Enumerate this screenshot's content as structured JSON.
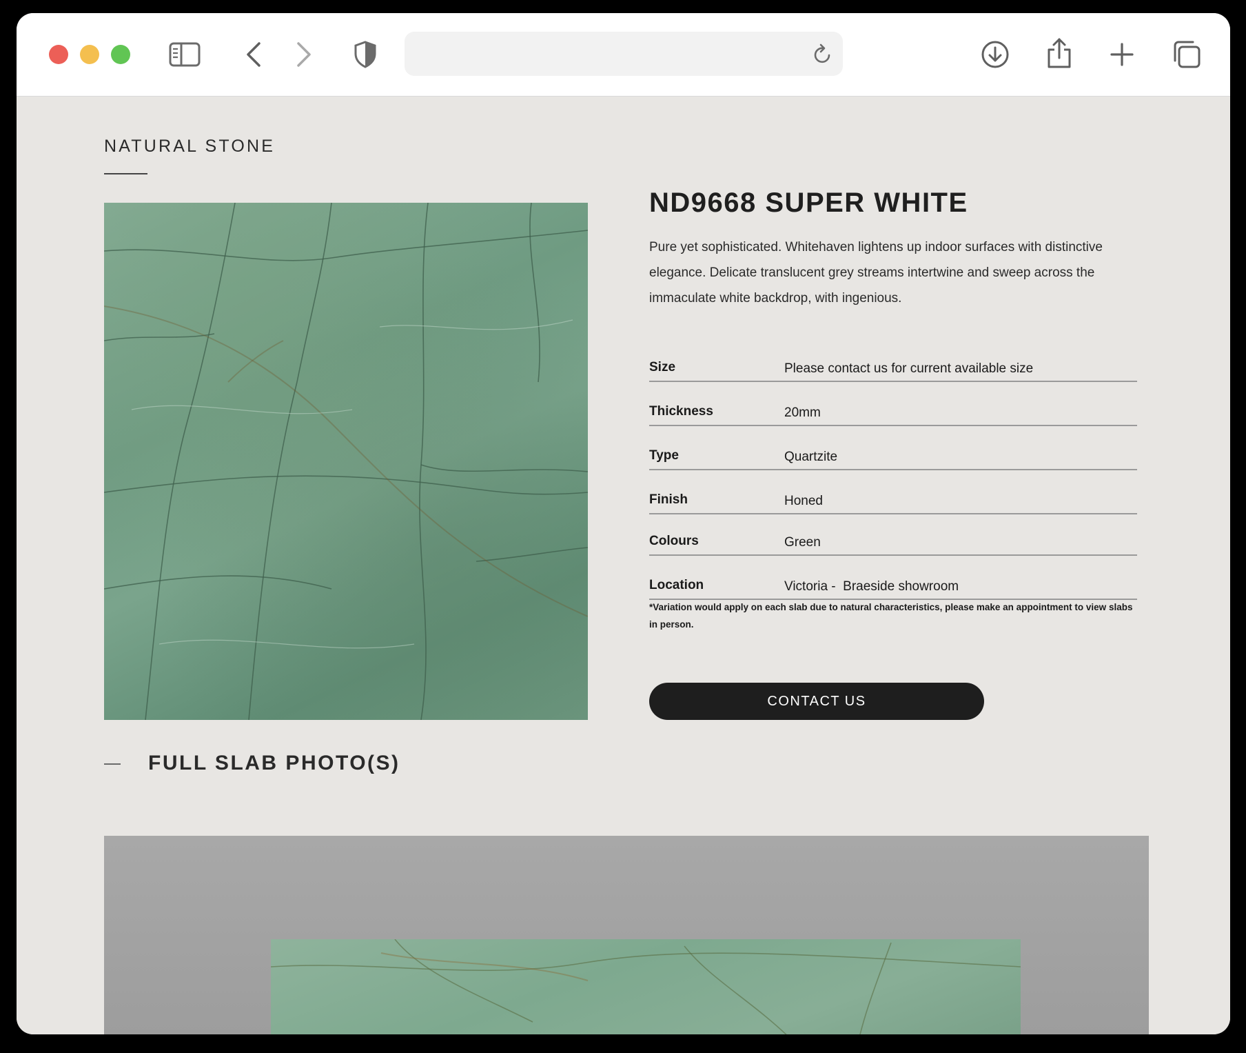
{
  "browser": {
    "address_value": "",
    "icons": {
      "sidebar": "sidebar-icon",
      "back": "chevron-left-icon",
      "forward": "chevron-right-icon",
      "privacy": "shield-icon",
      "reload": "reload-icon",
      "download": "download-icon",
      "share": "share-icon",
      "new_tab": "plus-icon",
      "tabs": "tabs-overview-icon"
    },
    "colors": {
      "close": "#ec5f57",
      "minimize": "#f4bf4f",
      "zoom": "#61c554"
    }
  },
  "page": {
    "section_label": "NATURAL STONE",
    "product": {
      "title": "ND9668 SUPER WHITE",
      "description": "Pure yet sophisticated. Whitehaven lightens up indoor surfaces with distinctive elegance. Delicate translucent grey streams intertwine and sweep across the immaculate white backdrop, with ingenious.",
      "specs": [
        {
          "key": "Size",
          "value": "Please contact us for current available size"
        },
        {
          "key": "Thickness",
          "value": "20mm"
        },
        {
          "key": "Type",
          "value": "Quartzite"
        },
        {
          "key": "Finish",
          "value": "Honed"
        },
        {
          "key": "Colours",
          "value": "Green"
        },
        {
          "key": "Location",
          "value": "Victoria -  Braeside showroom"
        }
      ],
      "note": "*Variation would apply on each slab due to natural characteristics, please make an appointment to view slabs in person.",
      "contact_label": "CONTACT US"
    },
    "slab_heading": "FULL SLAB PHOTO(S)"
  }
}
